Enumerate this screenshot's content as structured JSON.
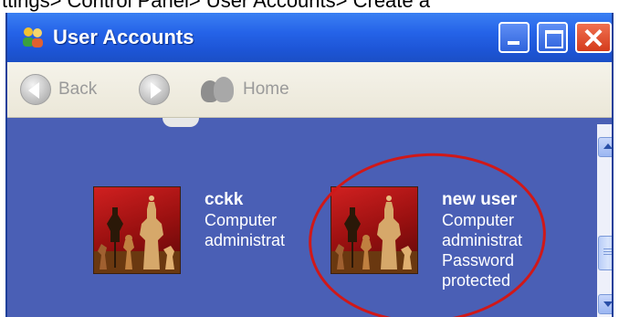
{
  "top_caption": "ttings> Control Panel> User Accounts> Create a",
  "window": {
    "title": "User Accounts"
  },
  "toolbar": {
    "back_label": "Back",
    "home_label": "Home"
  },
  "accounts": [
    {
      "name": "cckk",
      "lines": [
        "Computer",
        "administrat"
      ]
    },
    {
      "name": "new user",
      "lines": [
        "Computer",
        "administrat",
        "Password",
        "protected"
      ]
    }
  ],
  "colors": {
    "titlebar": "#2563e8",
    "content_bg": "#4a5fb5",
    "highlight_ellipse": "#d01818"
  }
}
